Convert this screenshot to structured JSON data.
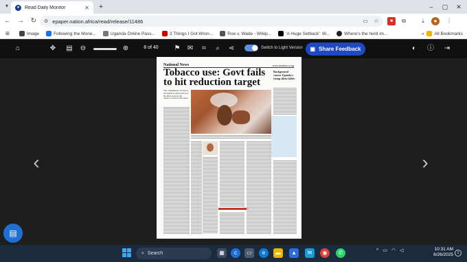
{
  "browser": {
    "tab_title": "Read Daily Monitor",
    "url": "epaper.nation.africa/read/release/11486",
    "new_tab_glyph": "+",
    "window_controls": [
      "–",
      "▢",
      "✕"
    ]
  },
  "bookmarks": {
    "items": [
      {
        "label": "Image",
        "color": "#444444"
      },
      {
        "label": "Following the Mone...",
        "color": "#1a73e8"
      },
      {
        "label": "Uganda Online Pass...",
        "color": "#777777"
      },
      {
        "label": "3 Things I Got Wron...",
        "color": "#cc0000"
      },
      {
        "label": "Roe v. Wade - Wikip...",
        "color": "#555555"
      },
      {
        "label": "'A Huge Setback': W...",
        "color": "#000000"
      },
      {
        "label": "Where's the herd im...",
        "color": "#222222"
      }
    ],
    "all_bookmarks": "All Bookmarks"
  },
  "viewer": {
    "page_counter": "8 of 40",
    "toggle_label": "Switch to Light Version",
    "feedback_label": "Share Feedback",
    "accent": "#1f49c4"
  },
  "newspaper": {
    "section": "National News",
    "site": "www.monitor.co.ug",
    "headline": "Tobacco use: Govt fails to hit reduction target",
    "side_headline": "Background causes Uganda's rising silent killer",
    "standfirst": "The consumption of tobacco in Uganda is often said to be the third-worst in the tobacco. Listen to this news."
  },
  "taskbar": {
    "search_label": "Search",
    "time": "10:31 AM",
    "date": "6/26/2025",
    "notification_count": "1"
  }
}
